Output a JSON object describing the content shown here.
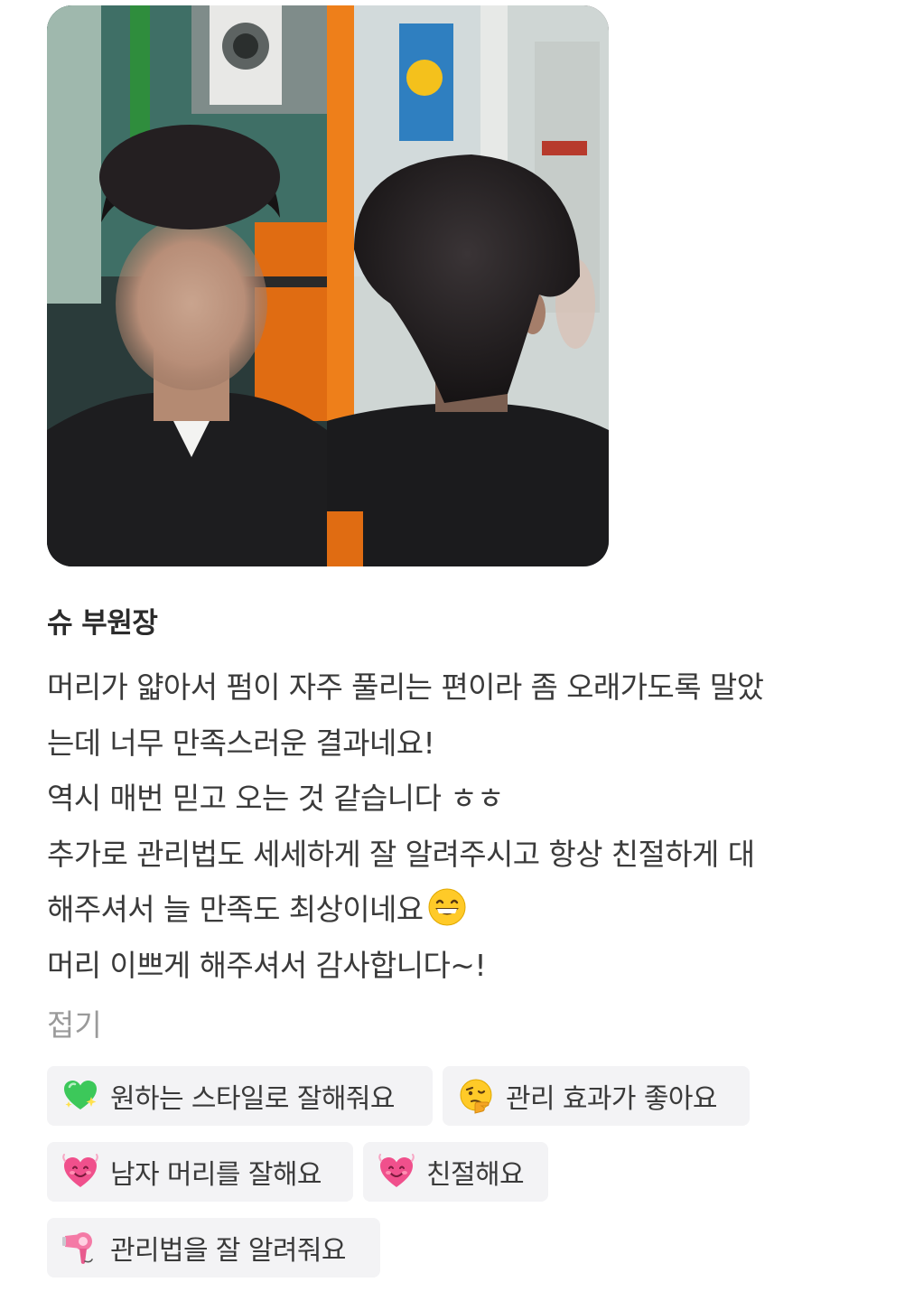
{
  "review": {
    "author": "슈 부원장",
    "lines": [
      "머리가 얇아서 펌이 자주 풀리는 편이라 좀 오래가도록 말았",
      "는데 너무 만족스러운 결과네요!",
      "역시 매번 믿고 오는 것 같습니다 ㅎㅎ",
      "추가로 관리법도 세세하게 잘 알려주시고 항상 친절하게 대",
      "해주셔서 늘 만족도 최상이네요",
      "머리 이쁘게 해주셔서 감사합니다~!"
    ],
    "fold_label": "접기"
  },
  "keywords": [
    {
      "label": "원하는 스타일로 잘해줘요",
      "icon": "green-sparkle-heart-icon"
    },
    {
      "label": "관리 효과가 좋아요",
      "icon": "thinking-face-icon"
    },
    {
      "label": "남자 머리를 잘해요",
      "icon": "smiling-heart-icon"
    },
    {
      "label": "친절해요",
      "icon": "smiling-heart-icon"
    },
    {
      "label": "관리법을 잘 알려줘요",
      "icon": "hair-dryer-icon"
    }
  ],
  "colors": {
    "chip_background": "#f3f3f5",
    "text": "#3a3a3a",
    "muted": "#9a9a9a",
    "heart_pink": "#f0508c",
    "heart_green": "#3cc85a"
  }
}
